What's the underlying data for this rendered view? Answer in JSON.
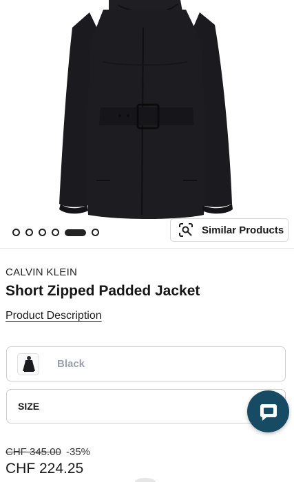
{
  "gallery": {
    "slide_count": 6,
    "active_index": 4,
    "similar_products_label": "Similar Products"
  },
  "product": {
    "brand": "CALVIN KLEIN",
    "title": "Short Zipped Padded Jacket",
    "description_link": "Product Description"
  },
  "color_selector": {
    "selected_color": "Black"
  },
  "size_selector": {
    "label": "SIZE"
  },
  "pricing": {
    "original_price": "CHF 345.00",
    "discount": "-35%",
    "current_price": "CHF 224.25"
  },
  "colors": {
    "chat_button": "#174a63",
    "jacket": "#1b1b1f",
    "muted_text": "#9aa1ac"
  },
  "icons": {
    "similar_products": "visual-search-icon",
    "chat": "chat-bubble-icon"
  }
}
